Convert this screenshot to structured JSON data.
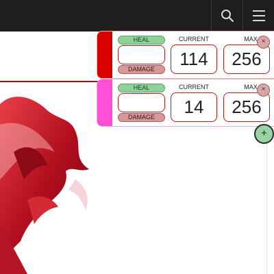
{
  "toolbar": {
    "search_icon": "search-icon",
    "menu_icon": "hamburger-menu-icon"
  },
  "trackers": [
    {
      "color": "#d80000",
      "heal_label": "HEAL",
      "damage_label": "DAMAGE",
      "amount": "",
      "current_label": "CURRENT",
      "current": "114",
      "max_label": "MAX",
      "max": "256",
      "remove_label": "×"
    },
    {
      "color": "#ff4fd8",
      "heal_label": "HEAL",
      "damage_label": "DAMAGE",
      "amount": "",
      "current_label": "CURRENT",
      "current": "14",
      "max_label": "MAX",
      "max": "256",
      "remove_label": "×"
    }
  ],
  "add_label": "+",
  "colors": {
    "topbar": "#1e1e1e",
    "accent_red": "#c21818",
    "heal_green": "#8ed29a",
    "damage_red": "#d79898"
  }
}
